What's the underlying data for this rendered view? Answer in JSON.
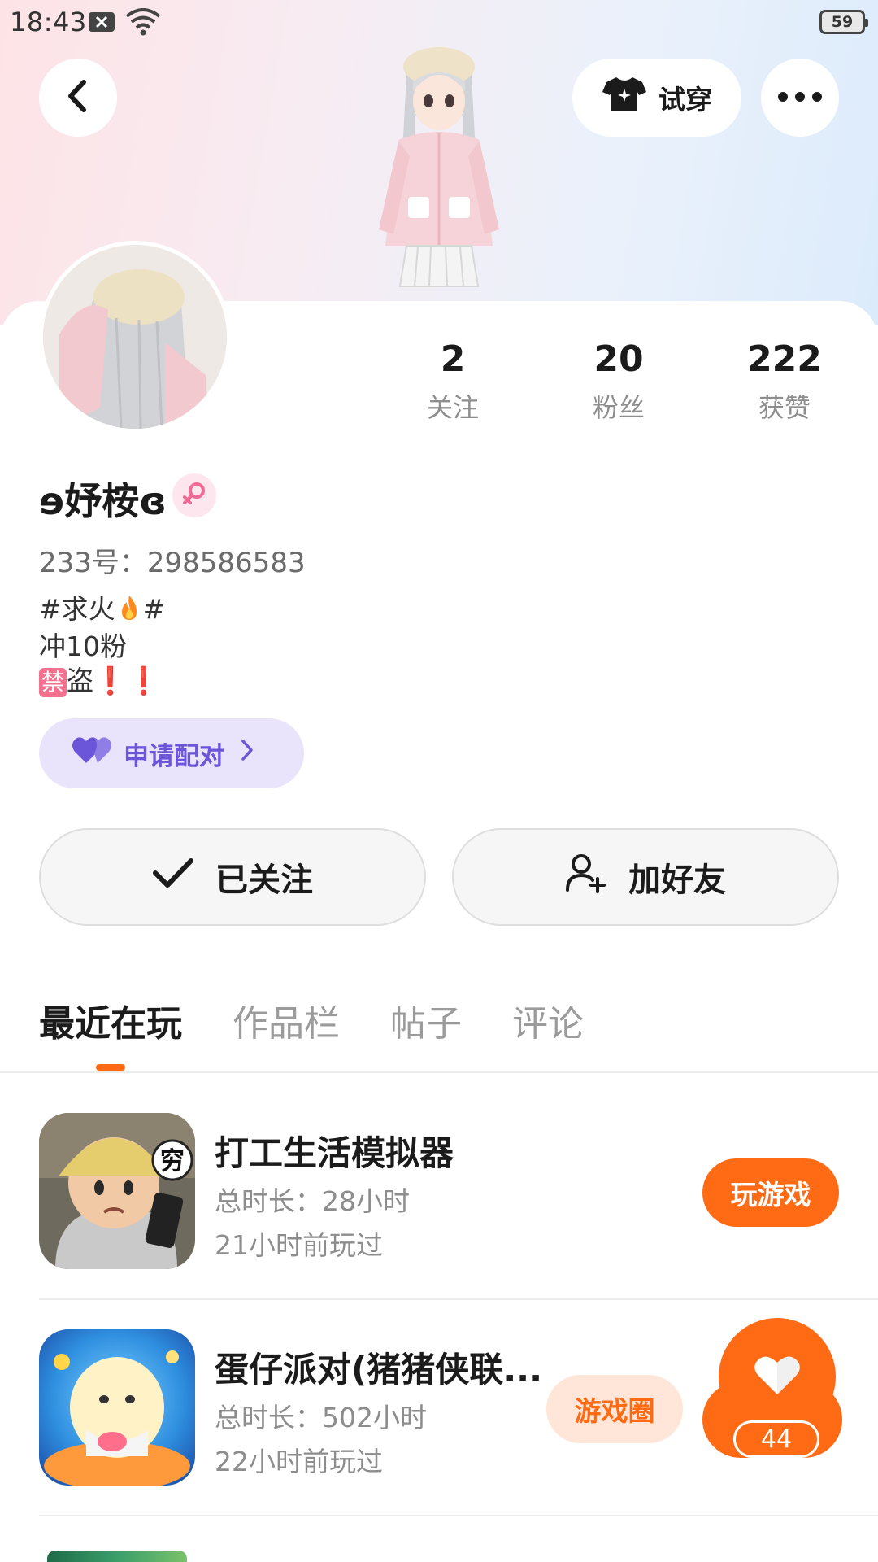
{
  "status_bar": {
    "time": "18:43",
    "battery": "59",
    "icons": [
      "notification-x-icon",
      "wifi-icon"
    ]
  },
  "header": {
    "back_icon": "chevron-left-icon",
    "try_on_label": "试穿",
    "try_on_icon": "tshirt-icon",
    "more_icon": "more-horizontal-icon"
  },
  "profile": {
    "username": "ɘ妤桉ɞ",
    "gender_icon": "female-icon",
    "account_id": "233号：298586583",
    "bio": {
      "line1_prefix": "#求火",
      "line1_suffix": "#",
      "line2": "冲10粉",
      "line3_badge": "禁",
      "line3_text": "盗",
      "line3_marks": "❗❗"
    },
    "stats": [
      {
        "value": "2",
        "label": "关注"
      },
      {
        "value": "20",
        "label": "粉丝"
      },
      {
        "value": "222",
        "label": "获赞"
      }
    ],
    "pair_button_label": "申请配对",
    "followed_label": "已关注",
    "add_friend_label": "加好友"
  },
  "tabs": [
    "最近在玩",
    "作品栏",
    "帖子",
    "评论"
  ],
  "active_tab": "最近在玩",
  "games": [
    {
      "title": "打工生活模拟器",
      "total_time": "总时长：28小时",
      "last_played": "21小时前玩过",
      "action": "玩游戏",
      "icon_text": "穷"
    },
    {
      "title": "蛋仔派对(猪猪侠联...",
      "total_time": "总时长：502小时",
      "last_played": "22小时前玩过",
      "action": "游戏圈"
    }
  ],
  "like_float": {
    "count": "44",
    "icon": "heart-icon"
  },
  "colors": {
    "accent": "#ff6a14",
    "pair_purple": "#6b55d8",
    "gender_pink": "#f06a95"
  }
}
